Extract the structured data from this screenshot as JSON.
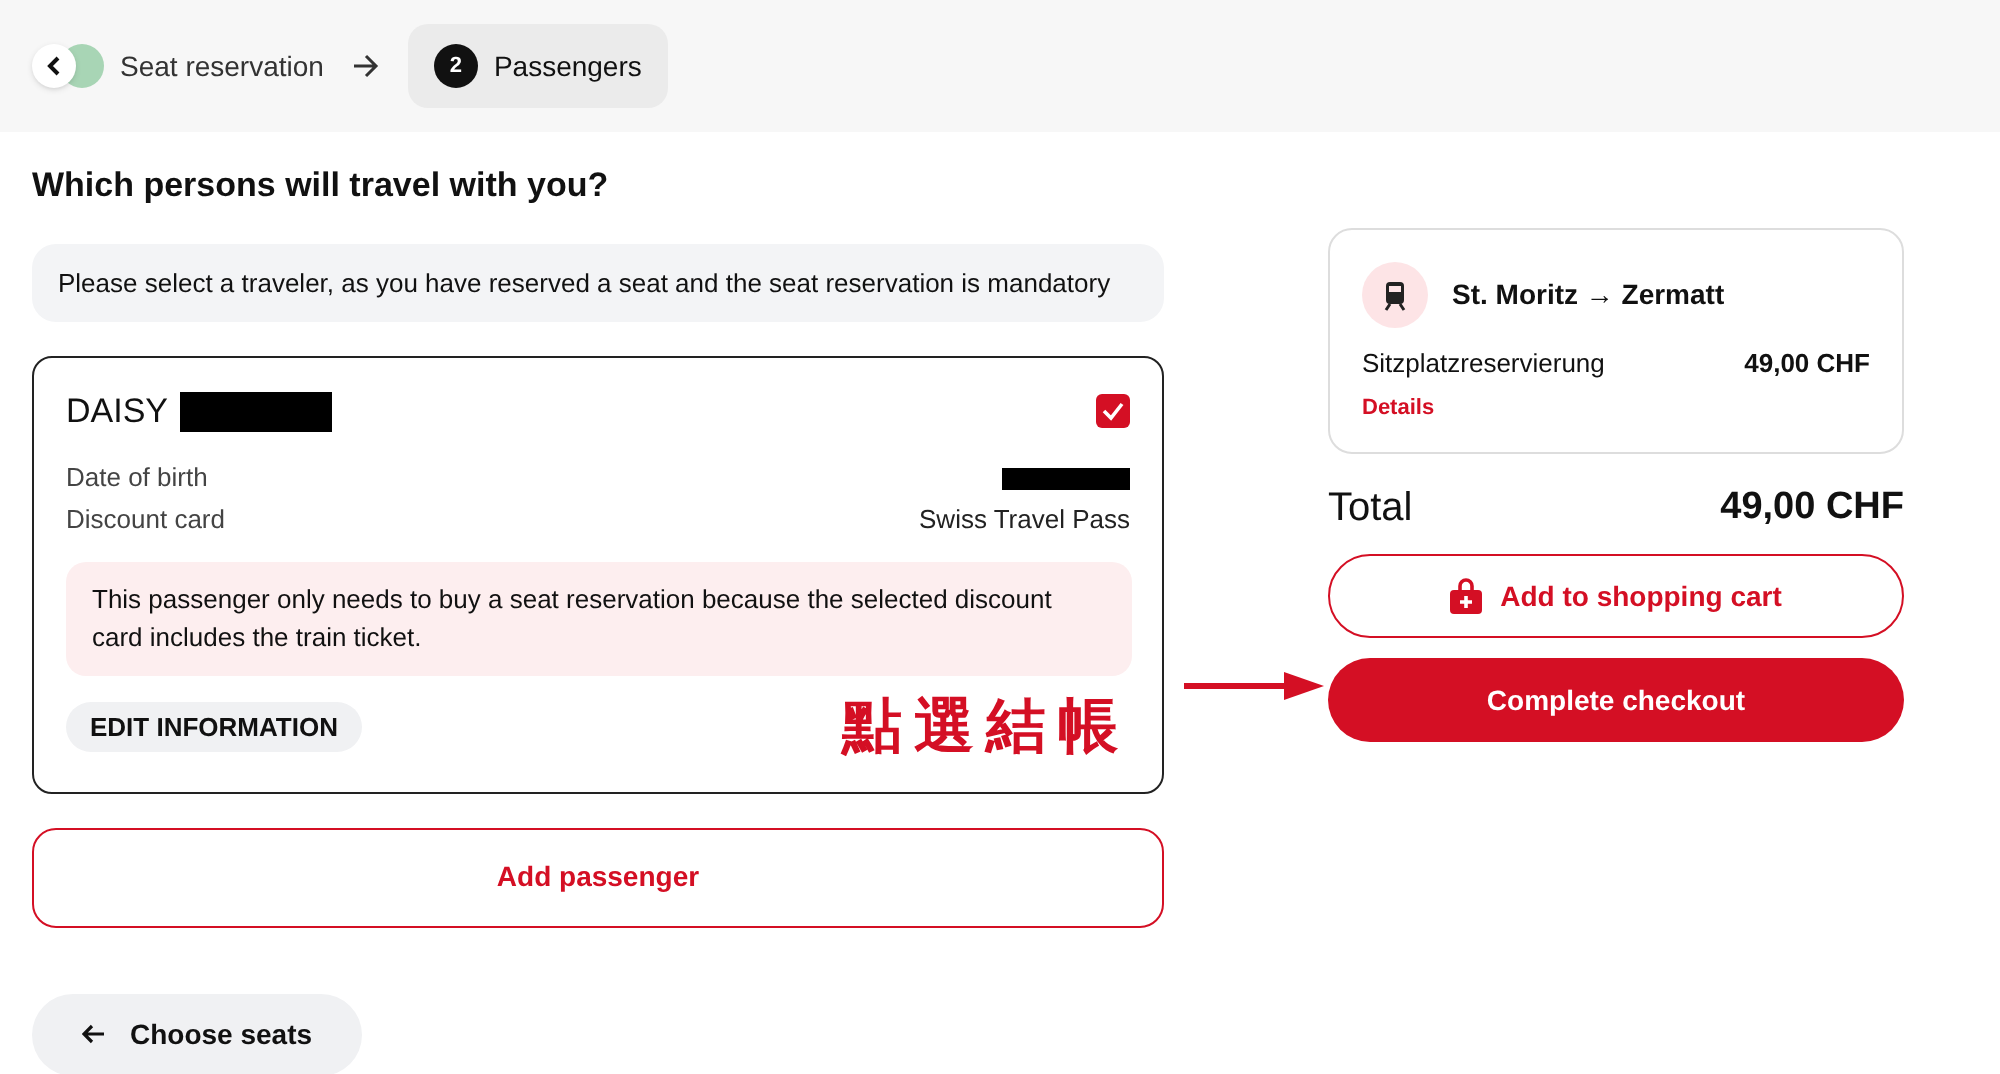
{
  "steps": [
    {
      "label": "Seat reservation",
      "selected": false,
      "completed": true
    },
    {
      "label": "Passengers",
      "number": "2",
      "selected": true,
      "completed": false
    }
  ],
  "heading": "Which persons will travel with you?",
  "notice": "Please select a traveler, as you have reserved a seat and the seat reservation is mandatory",
  "passenger": {
    "name": "DAISY",
    "checked": true,
    "details": [
      {
        "label": "Date of birth",
        "redacted": true
      },
      {
        "label": "Discount card",
        "value": "Swiss Travel Pass",
        "redacted": false
      }
    ],
    "info": "This passenger only needs to buy a seat reservation because the selected discount card includes the train ticket.",
    "edit_button": "EDIT INFORMATION"
  },
  "add_passenger": "Add passenger",
  "back_button": "Choose seats",
  "annotation": "點選結帳",
  "summary": {
    "route": "St. Moritz → Zermatt",
    "item": "Sitzplatzreservierung",
    "price": "49,00 CHF",
    "details_link": "Details"
  },
  "total_label": "Total",
  "total": "49,00 CHF",
  "cart_button": "Add to shopping cart",
  "checkout_button": "Complete checkout"
}
